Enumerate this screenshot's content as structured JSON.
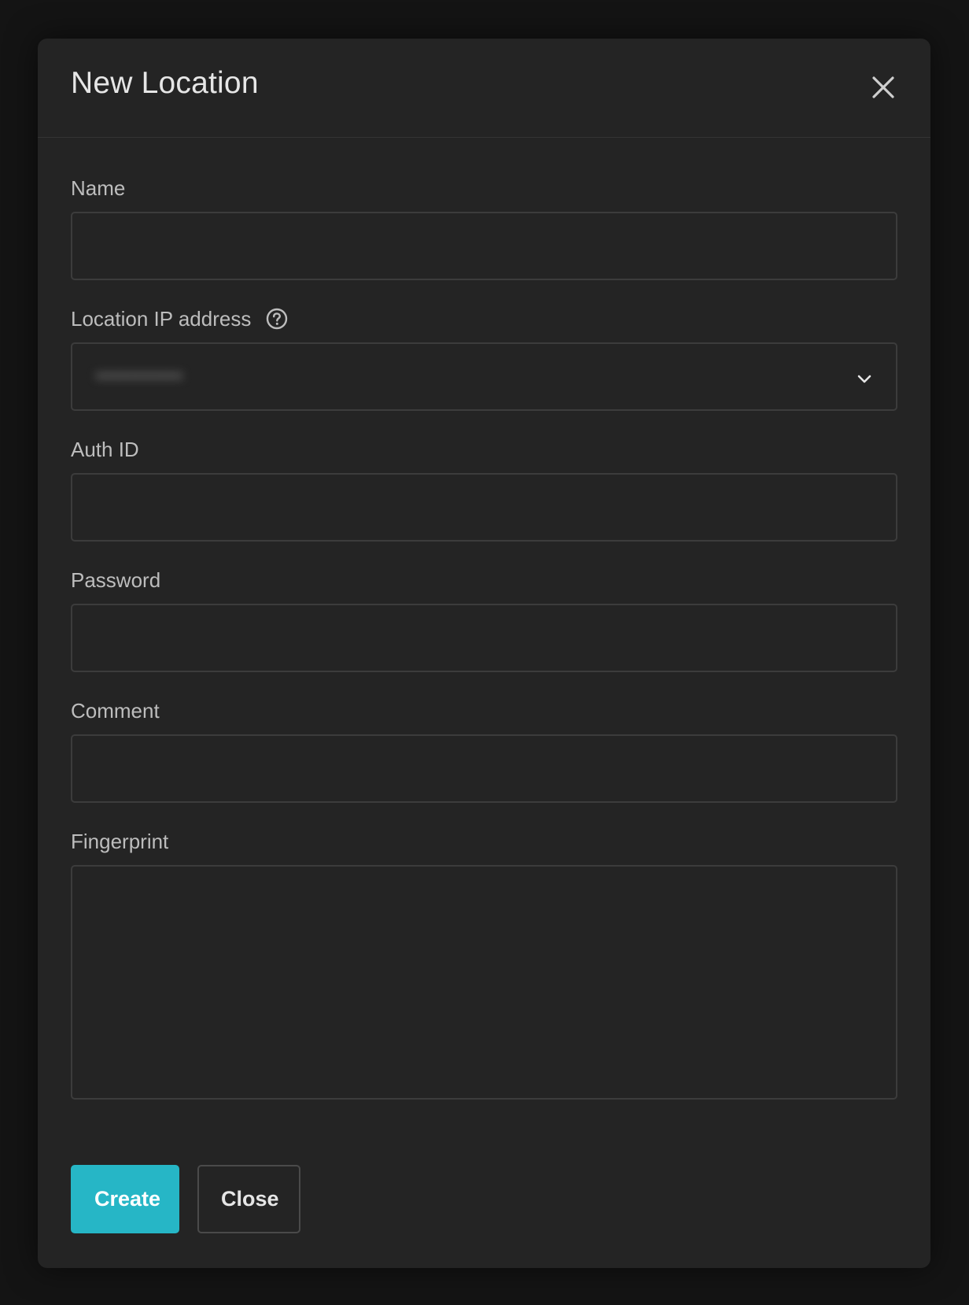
{
  "modal": {
    "title": "New Location",
    "close_icon": "close-icon"
  },
  "fields": {
    "name": {
      "label": "Name",
      "value": "",
      "placeholder": ""
    },
    "ip": {
      "label": "Location IP address",
      "help_icon": "question-circle-icon",
      "selected_value": "•••••••••••",
      "chevron_icon": "chevron-down-icon"
    },
    "auth_id": {
      "label": "Auth ID",
      "value": "",
      "placeholder": ""
    },
    "password": {
      "label": "Password",
      "value": "",
      "placeholder": ""
    },
    "comment": {
      "label": "Comment",
      "value": "",
      "placeholder": ""
    },
    "fingerprint": {
      "label": "Fingerprint",
      "value": "",
      "placeholder": ""
    }
  },
  "actions": {
    "create_label": "Create",
    "close_label": "Close"
  },
  "colors": {
    "background": "#141414",
    "modal": "#242424",
    "accent": "#26b6c6",
    "border": "#3c3c3c",
    "label": "#bdbdbd",
    "text": "#e6e6e6"
  }
}
